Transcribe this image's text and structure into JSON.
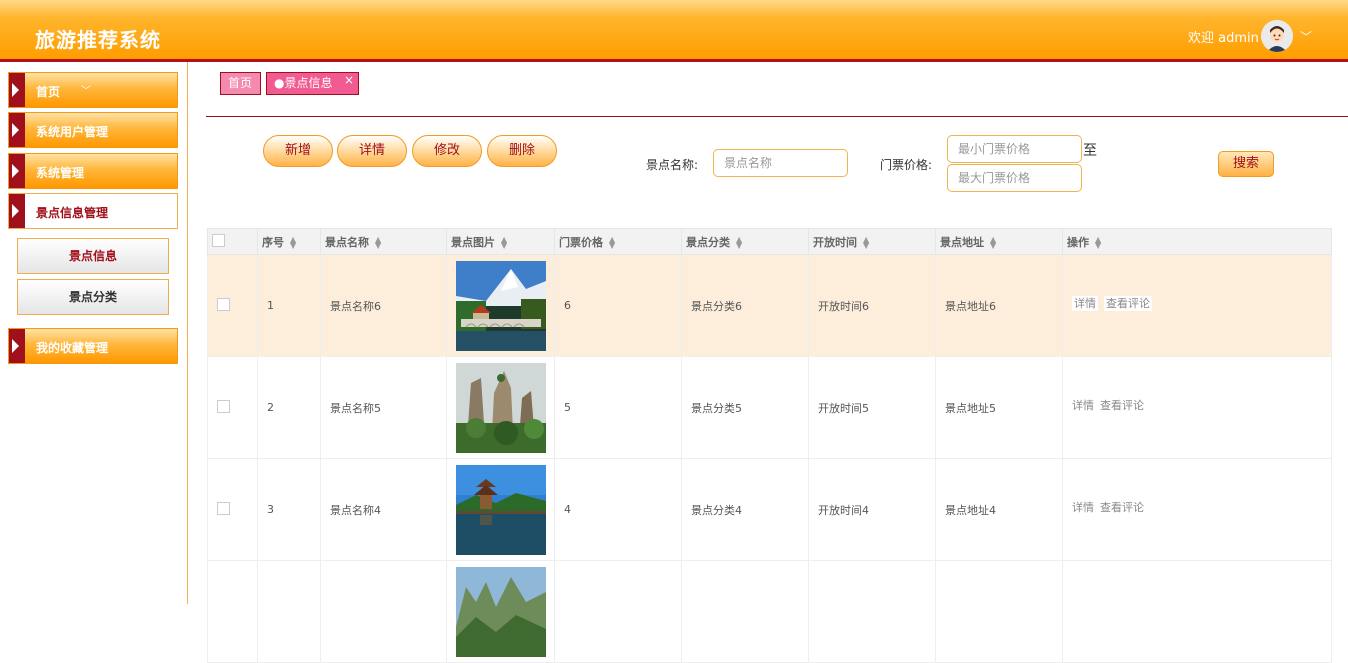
{
  "header": {
    "title": "旅游推荐系统",
    "welcome": "欢迎 admin"
  },
  "sidebar": {
    "items": [
      {
        "label": "首页"
      },
      {
        "label": "系统用户管理"
      },
      {
        "label": "系统管理"
      },
      {
        "label": "景点信息管理"
      },
      {
        "label": "我的收藏管理"
      }
    ],
    "sub_items": [
      {
        "label": "景点信息"
      },
      {
        "label": "景点分类"
      }
    ]
  },
  "tabs": {
    "home": "首页",
    "current": "●景点信息",
    "close": "×"
  },
  "actions": {
    "add": "新增",
    "detail": "详情",
    "edit": "修改",
    "delete": "删除"
  },
  "search": {
    "name_label": "景点名称:",
    "name_placeholder": "景点名称",
    "price_label": "门票价格:",
    "min_placeholder": "最小门票价格",
    "max_placeholder": "最大门票价格",
    "to": "至",
    "button": "搜索"
  },
  "table": {
    "columns": [
      "序号",
      "景点名称",
      "景点图片",
      "门票价格",
      "景点分类",
      "开放时间",
      "景点地址",
      "操作"
    ],
    "rows": [
      {
        "index": "1",
        "name": "景点名称6",
        "price": "6",
        "category": "景点分类6",
        "open_time": "开放时间6",
        "address": "景点地址6"
      },
      {
        "index": "2",
        "name": "景点名称5",
        "price": "5",
        "category": "景点分类5",
        "open_time": "开放时间5",
        "address": "景点地址5"
      },
      {
        "index": "3",
        "name": "景点名称4",
        "price": "4",
        "category": "景点分类4",
        "open_time": "开放时间4",
        "address": "景点地址4"
      }
    ],
    "op_detail": "详情",
    "op_comments": "查看评论"
  },
  "colors": {
    "brand_orange": "#ff9d00",
    "brand_red": "#a0101c",
    "highlight_row": "#fdeedc"
  }
}
